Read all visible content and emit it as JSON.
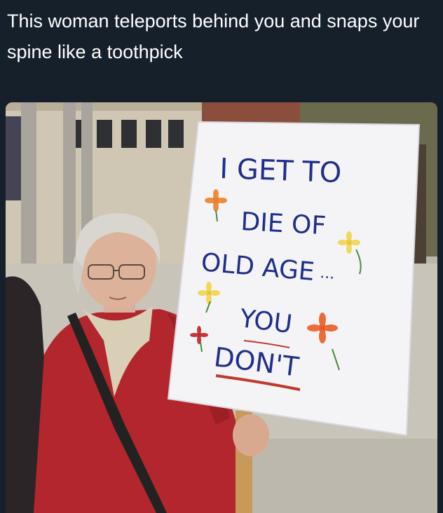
{
  "tweet": {
    "text": "This woman teleports behind you and snaps your spine like a toothpick"
  },
  "photo": {
    "sign": {
      "line1": "I GET TO",
      "line2": "DIE OF",
      "line3": "OLD AGE",
      "line3_suffix": "...",
      "line4": "YOU",
      "line5": "DON'T"
    }
  },
  "colors": {
    "background": "#15202b",
    "caption_text": "#ffffff",
    "sign_ink": "#1f2f8a",
    "underline": "#c0392b",
    "coat": "#b3262d"
  }
}
